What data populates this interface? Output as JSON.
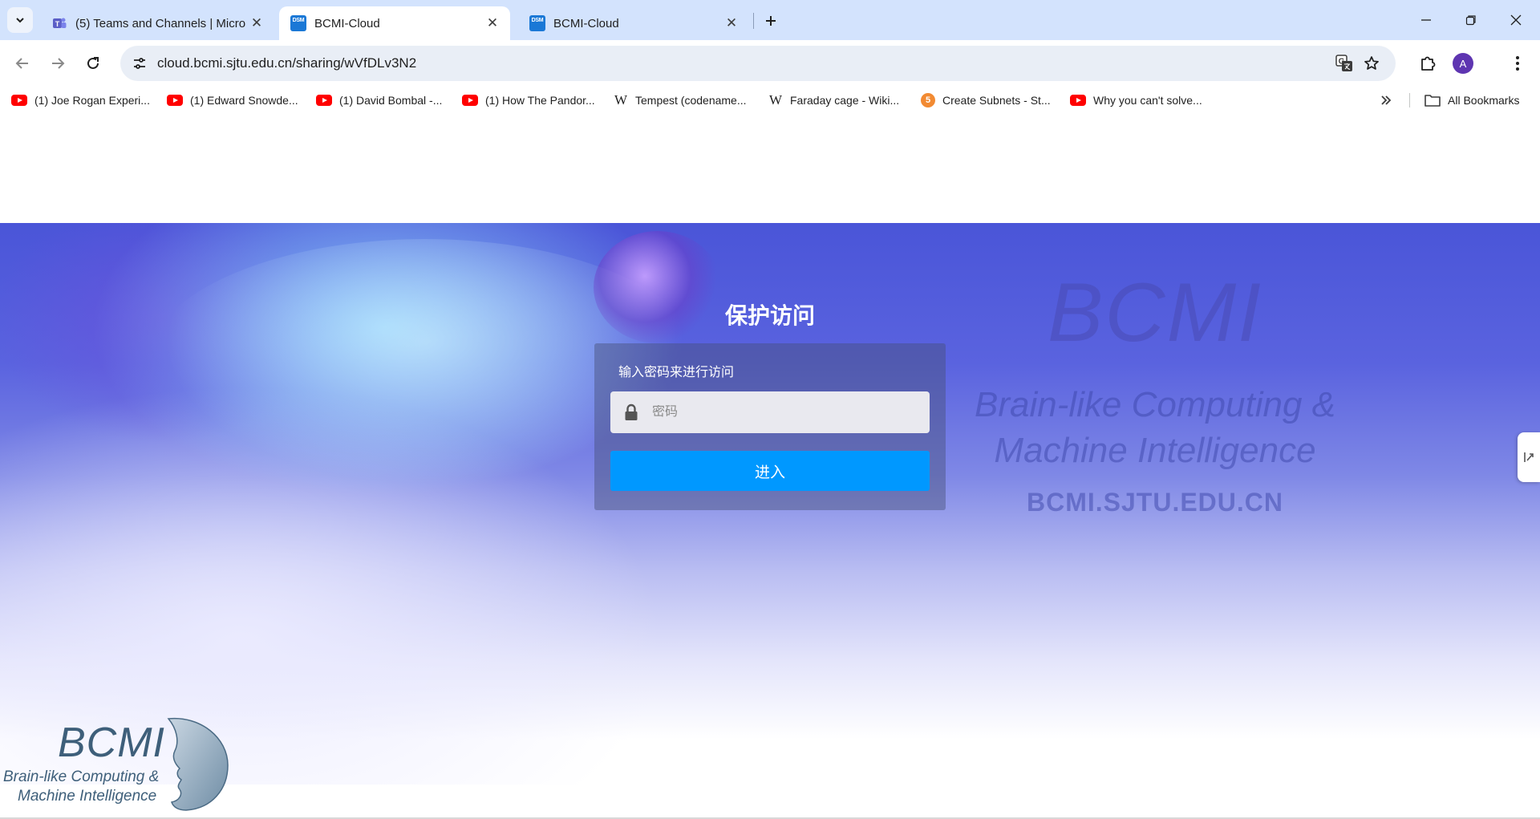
{
  "browser": {
    "tabs": [
      {
        "title": "(5) Teams and Channels | Micro",
        "favicon": "teams-icon",
        "active": false
      },
      {
        "title": "BCMI-Cloud",
        "favicon": "dsm-icon",
        "active": true
      },
      {
        "title": "BCMI-Cloud",
        "favicon": "dsm-icon",
        "active": false
      }
    ],
    "favicon_text": "DSM",
    "url": "cloud.bcmi.sjtu.edu.cn/sharing/wVfDLv3N2",
    "profile_initial": "A",
    "accent_color": "#d3e3fd"
  },
  "bookmarks": {
    "items": [
      {
        "label": "(1) Joe Rogan Experi...",
        "icon": "youtube-icon"
      },
      {
        "label": "(1) Edward Snowde...",
        "icon": "youtube-icon"
      },
      {
        "label": "(1) David Bombal -...",
        "icon": "youtube-icon"
      },
      {
        "label": "(1) How The Pandor...",
        "icon": "youtube-icon"
      },
      {
        "label": "Tempest (codename...",
        "icon": "wikipedia-icon"
      },
      {
        "label": "Faraday cage - Wiki...",
        "icon": "wikipedia-icon"
      },
      {
        "label": "Create Subnets - St...",
        "icon": "shield-5-icon"
      },
      {
        "label": "Why you can't solve...",
        "icon": "youtube-icon"
      }
    ],
    "wiki_glyph": "W",
    "shield_glyph": "5",
    "all_bookmarks": "All Bookmarks"
  },
  "page": {
    "title": "保护访问",
    "card_label": "输入密码来进行访问",
    "password_placeholder": "密码",
    "enter_button": "进入",
    "button_color": "#0098ff",
    "watermark": {
      "logo": "BCMI",
      "line1": "Brain-like Computing &",
      "line2": "Machine Intelligence",
      "url": "BCMI.SJTU.EDU.CN"
    },
    "footer_logo": {
      "logo": "BCMI",
      "line1": "Brain-like Computing &",
      "line2": "Machine Intelligence"
    }
  }
}
